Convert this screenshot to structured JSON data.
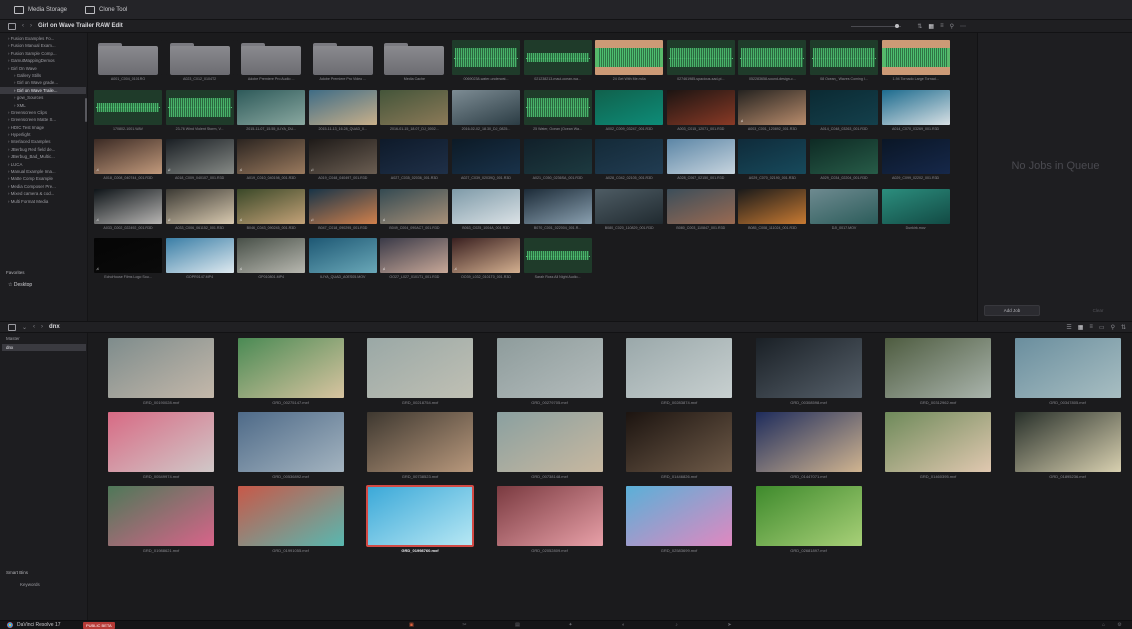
{
  "topbar": {
    "media_storage": "Media Storage",
    "clone_tool": "Clone Tool"
  },
  "pathbar": {
    "path": "Girl on Wave Trailer RAW Edit"
  },
  "sidebar": {
    "items": [
      {
        "label": "Fusion Examples Fo...",
        "indent": 1
      },
      {
        "label": "Fusion Manual Exam...",
        "indent": 1
      },
      {
        "label": "Fusion Sample Comp...",
        "indent": 1
      },
      {
        "label": "GamutMappingDemos",
        "indent": 1
      },
      {
        "label": "Girl On Wave",
        "indent": 1
      },
      {
        "label": "Gallery Stills",
        "indent": 2
      },
      {
        "label": "Girl on Wave grade...",
        "indent": 2
      },
      {
        "label": "Girl on Wave Traile...",
        "indent": 2,
        "selected": true
      },
      {
        "label": "gow_Sources",
        "indent": 2
      },
      {
        "label": "XML",
        "indent": 2
      },
      {
        "label": "Greenscreen Clips",
        "indent": 1
      },
      {
        "label": "Greenscreen Matte S...",
        "indent": 1
      },
      {
        "label": "HDIC Test Image",
        "indent": 1
      },
      {
        "label": "Hyperlight",
        "indent": 1
      },
      {
        "label": "Interlaced Examples",
        "indent": 1
      },
      {
        "label": "JBerbug Red field de...",
        "indent": 1
      },
      {
        "label": "JBerbug_Bad_Multic...",
        "indent": 1
      },
      {
        "label": "LUCA",
        "indent": 1
      },
      {
        "label": "Manual Example Ima...",
        "indent": 1
      },
      {
        "label": "Matte Comp Example",
        "indent": 1
      },
      {
        "label": "Media Composer Pre...",
        "indent": 1
      },
      {
        "label": "Mixed camera & cod...",
        "indent": 1
      },
      {
        "label": "Multi Format Media",
        "indent": 1
      }
    ],
    "favorites_label": "Favorites",
    "favorite_item": "Desktop"
  },
  "media": {
    "rows": [
      [
        {
          "label": "A001_C004_0101RO",
          "kind": "folder"
        },
        {
          "label": "A023_C012_0104T2",
          "kind": "folder"
        },
        {
          "label": "Adobe Premiere Pro Audio ...",
          "kind": "folder"
        },
        {
          "label": "Adobe Premiere Pro Video ...",
          "kind": "folder"
        },
        {
          "label": "Media Cache",
          "kind": "folder"
        },
        {
          "label": "00690238-water-underwat...",
          "kind": "wave"
        },
        {
          "label": "021238213-maui-ocean-wa...",
          "kind": "wave-thin"
        },
        {
          "label": "24 Get With Me.m4a",
          "kind": "wave-pink"
        },
        {
          "label": "027461985-spacious-sad-pi...",
          "kind": "wave"
        },
        {
          "label": "052283658-sound-design-c...",
          "kind": "wave"
        },
        {
          "label": "08 Ocean_ Waves Coming I...",
          "kind": "wave"
        },
        {
          "label": "1-94 Tornado Large Tornad...",
          "kind": "wave-pink"
        }
      ],
      [
        {
          "label": "170802-1001.WAV",
          "kind": "wave-thin"
        },
        {
          "label": "23-76 Wind Violent Storm, V...",
          "kind": "wave"
        },
        {
          "label": "2015-11-07_15.55_ILIYA_DU...",
          "kind": "video",
          "c1": "#2e5a5a",
          "c2": "#8aa8a0"
        },
        {
          "label": "2015-11-13_16.28_QUAD_0...",
          "kind": "video",
          "c1": "#3f6c86",
          "c2": "#c9b08a"
        },
        {
          "label": "2016-01-15_18.07_DJ_0002...",
          "kind": "video",
          "c1": "#44553a",
          "c2": "#8c7a58"
        },
        {
          "label": "2016-02-02_18.30_DJ_0825...",
          "kind": "video",
          "c1": "#7d8c94",
          "c2": "#2b3c44"
        },
        {
          "label": "25 Water, Ocean (Ocean Wa...",
          "kind": "wave"
        },
        {
          "label": "A002_C009_03247_001.R3D",
          "kind": "video",
          "c1": "#10614c",
          "c2": "#0d8c78"
        },
        {
          "label": "A003_C015_12071_001.R3D",
          "kind": "video",
          "c1": "#1c1412",
          "c2": "#8a3a26"
        },
        {
          "label": "A003_C001_120892_001.R3D",
          "kind": "video",
          "c1": "#252320",
          "c2": "#b98c6c",
          "audio": true
        },
        {
          "label": "A014_C048_03263_001.R3D",
          "kind": "video",
          "c1": "#0b2a33",
          "c2": "#14404c"
        },
        {
          "label": "A014_C070_03269_001.R3D",
          "kind": "video",
          "c1": "#1c6b8e",
          "c2": "#d8e0e4"
        }
      ],
      [
        {
          "label": "A018_C008_040744_001.R3D",
          "kind": "video",
          "c1": "#3b2a24",
          "c2": "#c29a7c",
          "audio": true
        },
        {
          "label": "A018_C009_040107_001.R3D",
          "kind": "video",
          "c1": "#1a1f24",
          "c2": "#868a86",
          "audio": true
        },
        {
          "label": "A019_C010_040198_001.R3D",
          "kind": "video",
          "c1": "#2b2420",
          "c2": "#9a7a5e",
          "audio": true
        },
        {
          "label": "A019_C048_040497_001.R3D",
          "kind": "video",
          "c1": "#1e1a18",
          "c2": "#6b5e52",
          "audio": true
        },
        {
          "label": "A027_C035_02036_001.R3D",
          "kind": "video",
          "c1": "#0e1a2a",
          "c2": "#1f3048"
        },
        {
          "label": "A027_C039_02039Q_001.R3D",
          "kind": "video",
          "c1": "#0c1a26",
          "c2": "#19324a"
        },
        {
          "label": "A021_C050_0236SA_001.R3D",
          "kind": "video",
          "c1": "#11202a",
          "c2": "#1d3a40"
        },
        {
          "label": "A028_C042_02105_001.R3D",
          "kind": "video",
          "c1": "#142a38",
          "c2": "#213c52"
        },
        {
          "label": "A028_C067_02150_001.R3D",
          "kind": "video",
          "c1": "#5c86a6",
          "c2": "#c7d4de"
        },
        {
          "label": "A029_C070_02190_001.R3D",
          "kind": "video",
          "c1": "#0f2b3a",
          "c2": "#174a5c"
        },
        {
          "label": "A029_C034_02204_001.R3D",
          "kind": "video",
          "c1": "#0e2a24",
          "c2": "#275c48"
        },
        {
          "label": "A029_C099_02202_001.R3D",
          "kind": "video",
          "c1": "#0a1626",
          "c2": "#16284a"
        }
      ],
      [
        {
          "label": "A033_C002_022492_001.R3D",
          "kind": "video",
          "c1": "#0e1418",
          "c2": "#b8b6b4",
          "audio": true
        },
        {
          "label": "A033_C006_061152_001.R3D",
          "kind": "video",
          "c1": "#3c3a34",
          "c2": "#d9cab0",
          "audio": true
        },
        {
          "label": "B046_C043_090245_001.R3D",
          "kind": "video",
          "c1": "#3a4828",
          "c2": "#c4a278",
          "audio": true
        },
        {
          "label": "B047_C018_090295_001.R3D",
          "kind": "video",
          "c1": "#183448",
          "c2": "#d0804c",
          "audio": true
        },
        {
          "label": "B049_C004_090AC7_001.R3D",
          "kind": "video",
          "c1": "#344a52",
          "c2": "#a89078",
          "audio": true
        },
        {
          "label": "B063_C025_1004A_001.R3D",
          "kind": "video",
          "c1": "#7e9aa8",
          "c2": "#dbe2e6"
        },
        {
          "label": "B070_C001_022004_001.R...",
          "kind": "video",
          "c1": "#1c2b38",
          "c2": "#8aa0b0"
        },
        {
          "label": "B080_C020_110829_001.R3D",
          "kind": "video",
          "c1": "#4e5c64",
          "c2": "#202a30"
        },
        {
          "label": "B080_C003_110847_001.R3D",
          "kind": "video",
          "c1": "#3c4e5a",
          "c2": "#9a6a52"
        },
        {
          "label": "B085_C008_111024_001.R3D",
          "kind": "video",
          "c1": "#1a1a1a",
          "c2": "#c87a32"
        },
        {
          "label": "DJI_0017.MOV",
          "kind": "video",
          "c1": "#6e8a90",
          "c2": "#2b5c5a"
        },
        {
          "label": "Dunkirk.mov",
          "kind": "video",
          "c1": "#2c8e7e",
          "c2": "#124a44"
        }
      ],
      [
        {
          "label": "EchoHouse Films Logo Sou...",
          "kind": "video",
          "c1": "#050505",
          "c2": "#0a0a0a",
          "audio": true
        },
        {
          "label": "GOPR0147.MP4",
          "kind": "video",
          "c1": "#3a7ea6",
          "c2": "#dfeaf0"
        },
        {
          "label": "GP010801.MP4",
          "kind": "video",
          "c1": "#485048",
          "c2": "#b8b8b0",
          "audio": true
        },
        {
          "label": "ILIYA_QUAD_A0ES05.MOV",
          "kind": "video",
          "c1": "#1e5874",
          "c2": "#6aa8b8"
        },
        {
          "label": "OO27_L027_0101T1_001.R3D",
          "kind": "video",
          "c1": "#3a3a48",
          "c2": "#c8a898",
          "audio": true
        },
        {
          "label": "OO39_L032_0101T0_001.R3D",
          "kind": "video",
          "c1": "#3a2020",
          "c2": "#d4b090",
          "audio": true
        },
        {
          "label": "Sarah Ross All Night Audio...",
          "kind": "wave-thin"
        }
      ]
    ]
  },
  "render_queue": {
    "empty_text": "No Jobs in Queue",
    "add_job": "Add Job",
    "clear": "Clear"
  },
  "bin": {
    "path": "dnx",
    "tree": [
      {
        "label": "Master",
        "selected": false
      },
      {
        "label": "dnx",
        "selected": true
      }
    ],
    "smart_bins": "Smart Bins",
    "keywords": "Keywords",
    "clips": [
      [
        {
          "label": "GRD_00190028.mxf",
          "c1": "#7e8c8c",
          "c2": "#c4b8aa"
        },
        {
          "label": "GRD_00275147.mxf",
          "c1": "#4a8a54",
          "c2": "#d8c4a0"
        },
        {
          "label": "GRD_00218754.mxf",
          "c1": "#9aa8a6",
          "c2": "#c0c0b4"
        },
        {
          "label": "GRD_00279705.mxf",
          "c1": "#8e9c9c",
          "c2": "#b4bcbc"
        },
        {
          "label": "GRD_00283874.mxf",
          "c1": "#9aa8aa",
          "c2": "#c8d0d0"
        },
        {
          "label": "GRD_00308598.mxf",
          "c1": "#1a2026",
          "c2": "#56606a"
        },
        {
          "label": "GRD_00312962.mxf",
          "c1": "#4e5c40",
          "c2": "#aab4ac"
        },
        {
          "label": "GRD_00347805.mxf",
          "c1": "#6a8e9e",
          "c2": "#a8bec2"
        }
      ],
      [
        {
          "label": "GRD_00549974.mxf",
          "c1": "#d86a84",
          "c2": "#d0c8c8"
        },
        {
          "label": "GRD_00536892.mxf",
          "c1": "#4e6a88",
          "c2": "#a4b4c0"
        },
        {
          "label": "GRD_00738523.mxf",
          "c1": "#3e3830",
          "c2": "#b8987c"
        },
        {
          "label": "GRD_00738148.mxf",
          "c1": "#8aa0a0",
          "c2": "#c8b8a0"
        },
        {
          "label": "GRD_01446826.mxf",
          "c1": "#1c1410",
          "c2": "#6e5a48"
        },
        {
          "label": "GRD_01447071.mxf",
          "c1": "#1e2c5c",
          "c2": "#d0b490"
        },
        {
          "label": "GRD_01460395.mxf",
          "c1": "#6e8a5a",
          "c2": "#e0c8b0"
        },
        {
          "label": "GRD_01895236.mxf",
          "c1": "#28302a",
          "c2": "#d8d0b0"
        }
      ],
      [
        {
          "label": "GRD_01988621.mxf",
          "c1": "#4e7858",
          "c2": "#d8648a"
        },
        {
          "label": "GRD_01991055.mxf",
          "c1": "#c85848",
          "c2": "#58b8b0"
        },
        {
          "label": "GRD_01998760.mxf",
          "c1": "#3aa8d8",
          "c2": "#b8e8f4",
          "selected": true
        },
        {
          "label": "GRD_02052809.mxf",
          "c1": "#7a3a40",
          "c2": "#e8a0a8"
        },
        {
          "label": "GRD_02583699.mxf",
          "c1": "#5ab0d8",
          "c2": "#e088c0"
        },
        {
          "label": "GRD_02681897.mxf",
          "c1": "#3e8a2c",
          "c2": "#a8d078"
        }
      ]
    ]
  },
  "bottombar": {
    "app_name": "DaVinci Resolve 17",
    "badge": "PUBLIC BETA",
    "pages": [
      "media-page-icon",
      "cut-page-icon",
      "edit-page-icon",
      "fusion-page-icon",
      "color-page-icon",
      "fairlight-page-icon",
      "deliver-page-icon"
    ]
  }
}
